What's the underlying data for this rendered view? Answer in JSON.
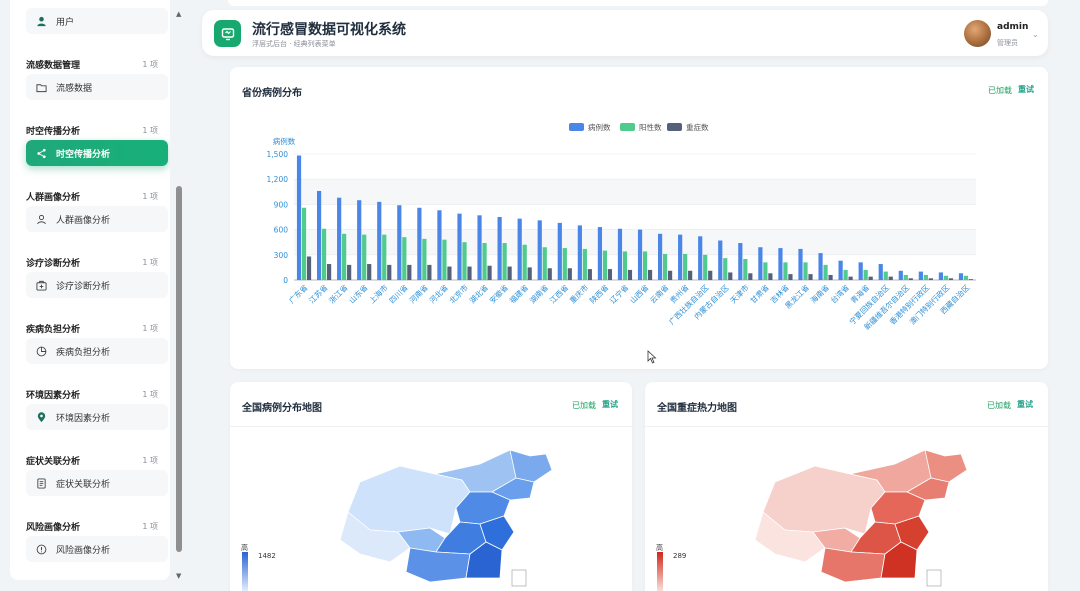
{
  "sidebar": {
    "top_item": {
      "label": "用户"
    },
    "groups": [
      {
        "title": "流感数据管理",
        "count": "1 项",
        "item": "流感数据",
        "icon": "folder-icon"
      },
      {
        "title": "时空传播分析",
        "count": "1 项",
        "item": "时空传播分析",
        "icon": "share-icon",
        "active": true
      },
      {
        "title": "人群画像分析",
        "count": "1 项",
        "item": "人群画像分析",
        "icon": "user-icon"
      },
      {
        "title": "诊疗诊断分析",
        "count": "1 项",
        "item": "诊疗诊断分析",
        "icon": "medical-kit-icon"
      },
      {
        "title": "疾病负担分析",
        "count": "1 项",
        "item": "疾病负担分析",
        "icon": "pie-icon"
      },
      {
        "title": "环境因素分析",
        "count": "1 项",
        "item": "环境因素分析",
        "icon": "location-pin-icon"
      },
      {
        "title": "症状关联分析",
        "count": "1 项",
        "item": "症状关联分析",
        "icon": "document-icon"
      },
      {
        "title": "风险画像分析",
        "count": "1 项",
        "item": "风险画像分析",
        "icon": "alert-circle-icon"
      }
    ]
  },
  "header": {
    "title": "流行感冒数据可视化系统",
    "subtitle": "浮层式后台 · 经典列表菜单",
    "user_name": "admin",
    "user_role": "管理员"
  },
  "cards": {
    "province": {
      "title": "省份病例分布",
      "status": "已加载",
      "retry": "重试"
    },
    "case_map": {
      "title": "全国病例分布地图",
      "status": "已加载",
      "retry": "重试",
      "legend_high": "高",
      "legend_value": "1482"
    },
    "severe_map": {
      "title": "全国重症热力地图",
      "status": "已加载",
      "retry": "重试",
      "legend_high": "高",
      "legend_value": "289"
    }
  },
  "colors": {
    "cases": "#4a86e8",
    "positive": "#4ecb8d",
    "severe": "#55607a",
    "accent": "#16a86f"
  },
  "chart_data": {
    "type": "bar",
    "ylabel": "病例数",
    "ylim": [
      0,
      1500
    ],
    "yticks": [
      "0",
      "300",
      "600",
      "900",
      "1,200",
      "1,500"
    ],
    "legend_position": "top-center",
    "categories": [
      "广东省",
      "江苏省",
      "浙江省",
      "山东省",
      "上海市",
      "四川省",
      "河南省",
      "河北省",
      "北京市",
      "湖北省",
      "安徽省",
      "福建省",
      "湖南省",
      "江西省",
      "重庆市",
      "陕西省",
      "辽宁省",
      "山西省",
      "云南省",
      "贵州省",
      "广西壮族自治区",
      "内蒙古自治区",
      "天津市",
      "甘肃省",
      "吉林省",
      "黑龙江省",
      "海南省",
      "台湾省",
      "青海省",
      "宁夏回族自治区",
      "新疆维吾尔自治区",
      "香港特别行政区",
      "澳门特别行政区",
      "西藏自治区"
    ],
    "series": [
      {
        "name": "病例数",
        "values": [
          1482,
          1060,
          980,
          950,
          930,
          890,
          860,
          830,
          790,
          770,
          750,
          730,
          710,
          680,
          650,
          630,
          610,
          600,
          550,
          540,
          520,
          470,
          440,
          390,
          380,
          370,
          320,
          230,
          210,
          190,
          110,
          100,
          90,
          80
        ]
      },
      {
        "name": "阳性数",
        "values": [
          860,
          610,
          550,
          540,
          540,
          510,
          490,
          480,
          450,
          440,
          440,
          420,
          390,
          380,
          370,
          350,
          340,
          340,
          310,
          310,
          300,
          260,
          250,
          210,
          210,
          210,
          180,
          120,
          120,
          100,
          60,
          60,
          50,
          50
        ]
      },
      {
        "name": "重症数",
        "values": [
          280,
          190,
          180,
          190,
          180,
          180,
          180,
          160,
          160,
          170,
          160,
          150,
          140,
          140,
          130,
          130,
          120,
          120,
          110,
          110,
          110,
          90,
          80,
          80,
          70,
          70,
          60,
          40,
          40,
          40,
          20,
          20,
          20,
          10
        ]
      }
    ]
  }
}
